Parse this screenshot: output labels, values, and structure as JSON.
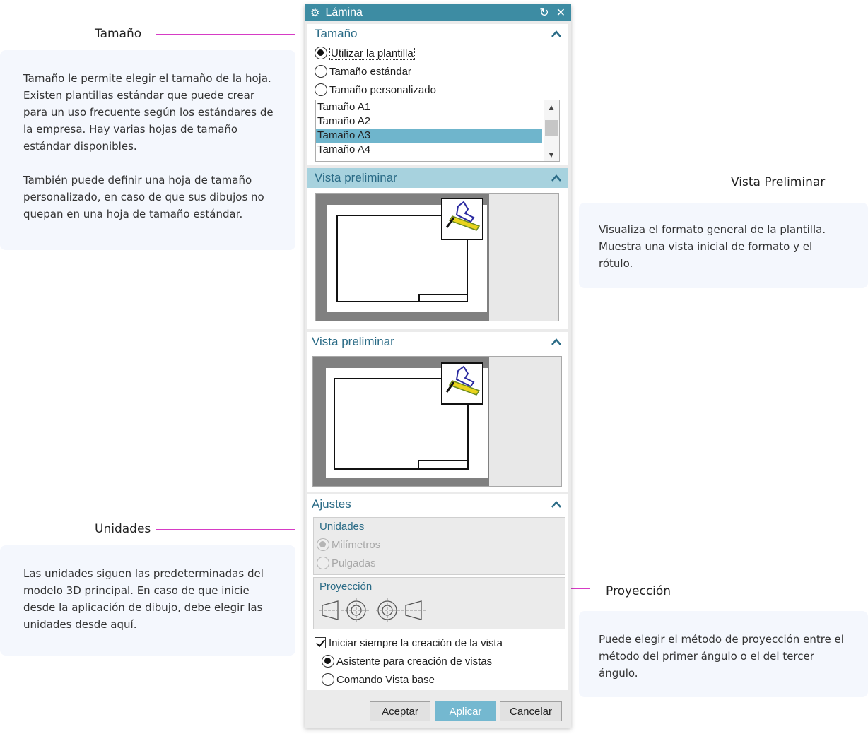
{
  "annotations": {
    "tamano": {
      "title": "Tamaño",
      "text1": "Tamaño le permite elegir el tamaño de la hoja. Existen plantillas estándar que puede crear para un uso frecuente según los estándares de la empresa. Hay varias hojas de tamaño estándar disponibles.",
      "text2": "También puede definir una hoja de tamaño personalizado, en caso de que sus dibujos no quepan en una hoja de tamaño estándar."
    },
    "vista": {
      "title": "Vista Preliminar",
      "text": "Visualiza el formato general  de la plantilla. Muestra una vista inicial de formato y el rótulo."
    },
    "unidades": {
      "title": "Unidades",
      "text": "Las unidades siguen las predeterminadas del modelo 3D principal. En caso de que inicie desde la aplicación de dibujo, debe elegir las unidades desde aquí."
    },
    "proyeccion": {
      "title": "Proyección",
      "text": "Puede elegir el método de proyección entre el método del primer ángulo o el del tercer ángulo."
    }
  },
  "dialog": {
    "title": "Lámina",
    "size": {
      "header": "Tamaño",
      "options": [
        "Utilizar la plantilla",
        "Tamaño estándar",
        "Tamaño personalizado"
      ],
      "selected_option": 0,
      "list": [
        "Tamaño A1",
        "Tamaño A2",
        "Tamaño A3",
        "Tamaño A4"
      ],
      "selected_item": 2
    },
    "preview1": {
      "header": "Vista preliminar"
    },
    "preview2": {
      "header": "Vista preliminar"
    },
    "settings": {
      "header": "Ajustes",
      "units_title": "Unidades",
      "units": [
        "Milímetros",
        "Pulgadas"
      ],
      "units_selected": 0,
      "projection_title": "Proyección",
      "always_start_label": "Iniciar siempre la creación de la vista",
      "always_start_checked": true,
      "mode_options": [
        "Asistente para creación de vistas",
        "Comando Vista base"
      ],
      "mode_selected": 0
    },
    "buttons": {
      "ok": "Aceptar",
      "apply": "Aplicar",
      "cancel": "Cancelar"
    }
  },
  "colors": {
    "accent": "#3d8ca3",
    "annotation_line": "#d63bc5",
    "note_bg": "#f4f7fd",
    "header_text": "#2a6b86"
  }
}
